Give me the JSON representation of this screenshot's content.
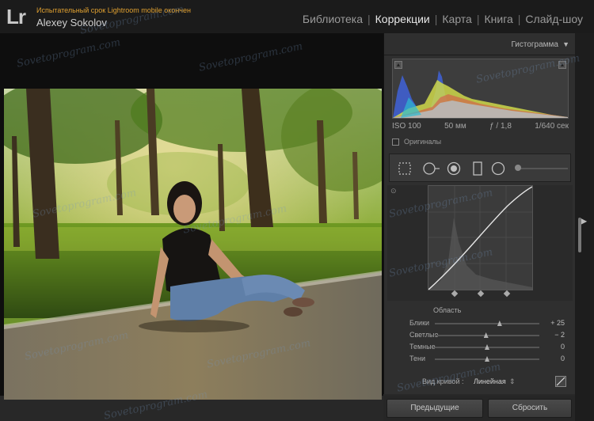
{
  "app": {
    "logo": "Lr",
    "trial_notice": "Испытательный срок Lightroom mobile окончен",
    "user_name": "Alexey Sokolov"
  },
  "modules": {
    "items": [
      "Библиотека",
      "Коррекции",
      "Карта",
      "Книга",
      "Слайд-шоу"
    ],
    "active": "Коррекции"
  },
  "histogram": {
    "title": "Гистограмма",
    "toggle_icon": "triangle-down-icon",
    "iso": "ISO 100",
    "focal": "50 мм",
    "aperture": "ƒ / 1,8",
    "shutter": "1/640 сек",
    "originals_label": "Оригиналы"
  },
  "tools": [
    "crop-overlay-icon",
    "spot-removal-icon",
    "red-eye-icon",
    "graduated-filter-icon",
    "radial-filter-icon",
    "adjustment-brush-icon"
  ],
  "tone_curve": {
    "region_label": "Область",
    "sliders": [
      {
        "label": "Блики",
        "value": "+ 25",
        "level": 0.62
      },
      {
        "label": "Светлые",
        "value": "− 2",
        "level": 0.49
      },
      {
        "label": "Темные",
        "value": "0",
        "level": 0.5
      },
      {
        "label": "Тени",
        "value": "0",
        "level": 0.5
      }
    ],
    "curve_type_label": "Вид кривой :",
    "curve_type_value": "Линейная",
    "curve_type_arrows": "⇕"
  },
  "bottom_buttons": {
    "previous": "Предыдущие",
    "reset": "Сбросить"
  },
  "watermark_text": "Sovetoprogram.com"
}
